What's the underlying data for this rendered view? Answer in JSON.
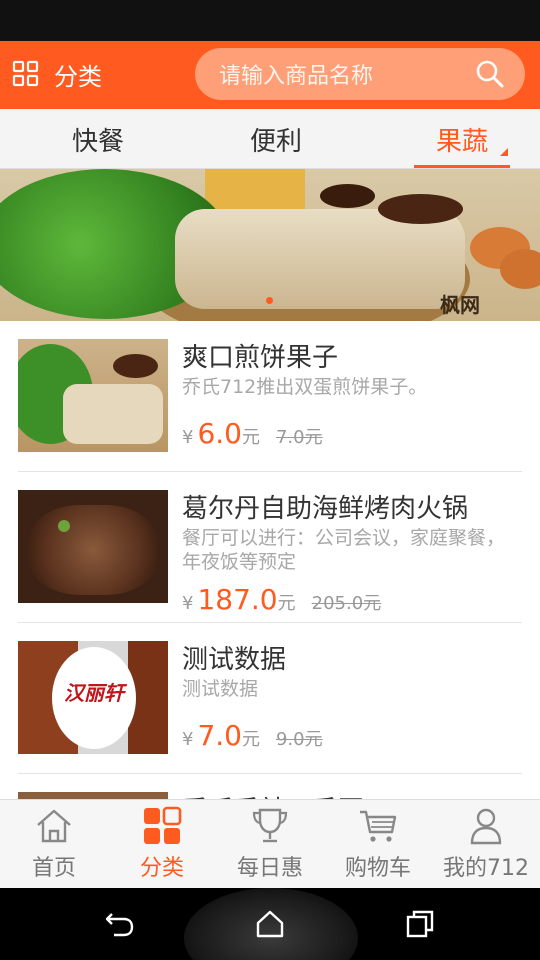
{
  "header": {
    "category_label": "分类",
    "search_placeholder": "请输入商品名称"
  },
  "tabs": [
    {
      "label": "快餐",
      "active": false
    },
    {
      "label": "便利",
      "active": false
    },
    {
      "label": "果蔬",
      "active": true
    }
  ],
  "banner": {
    "watermark": "枫网",
    "page_count": 1
  },
  "products": [
    {
      "title": "爽口煎饼果子",
      "description": "乔氏712推出双蛋煎饼果子。",
      "currency": "¥",
      "price": "6.0",
      "unit": "元",
      "original_price": "7.0元"
    },
    {
      "title": "葛尔丹自助海鲜烤肉火锅",
      "description": "餐厅可以进行：公司会议，家庭聚餐，年夜饭等预定",
      "currency": "¥",
      "price": "187.0",
      "unit": "元",
      "original_price": "205.0元"
    },
    {
      "title": "测试数据",
      "description": "测试数据",
      "currency": "¥",
      "price": "7.0",
      "unit": "元",
      "original_price": "9.0元",
      "thumb_logo_text": "汉丽轩"
    },
    {
      "title": "乔氏香辣五香豆"
    }
  ],
  "bottom_nav": [
    {
      "label": "首页",
      "icon": "home-icon",
      "active": false
    },
    {
      "label": "分类",
      "icon": "category-icon",
      "active": true
    },
    {
      "label": "每日惠",
      "icon": "trophy-icon",
      "active": false
    },
    {
      "label": "购物车",
      "icon": "cart-icon",
      "active": false
    },
    {
      "label": "我的712",
      "icon": "person-icon",
      "active": false
    }
  ],
  "colors": {
    "accent": "#ff5a1f",
    "search_bg": "#ff9f78",
    "tab_bg": "#f4f4f4",
    "muted_text": "#a8a8a8"
  }
}
